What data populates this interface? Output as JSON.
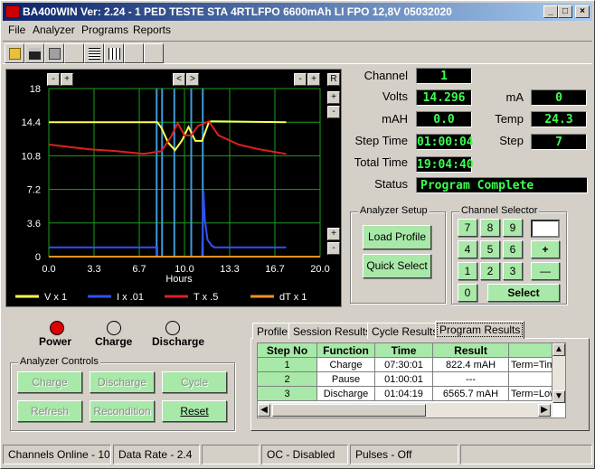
{
  "window": {
    "title": "BA400WIN Ver: 2.24 - 1 PED TESTE STA 4RTLFPO 6600mAh  LI FPO 12,8V 05032020",
    "controls": [
      "_",
      "□",
      "×"
    ]
  },
  "menu": [
    "File",
    "Analyzer",
    "Programs",
    "Reports"
  ],
  "toolbar": {
    "icons": [
      "open-folder-icon",
      "save-disk-icon",
      "print-icon",
      "grid-icon",
      "list-icon"
    ]
  },
  "chart": {
    "zoom_buttons": [
      "-",
      "+",
      "<",
      ">",
      "-",
      "+",
      "R",
      "+",
      "-",
      "+",
      "-"
    ],
    "xlabel": "Hours"
  },
  "chart_data": {
    "type": "line",
    "xlabel": "Hours",
    "xlim": [
      0.0,
      20.0
    ],
    "ylim": [
      0,
      18
    ],
    "x_ticks": [
      "0.0",
      "3.3",
      "6.7",
      "10.0",
      "13.3",
      "16.7",
      "20.0"
    ],
    "y_ticks": [
      "18",
      "14.4",
      "10.8",
      "7.2",
      "3.6",
      "0"
    ],
    "grid": true,
    "legend_position": "bottom",
    "series": [
      {
        "name": "V x 1",
        "color": "#ffff50",
        "x": [
          0,
          8,
          8.3,
          8.8,
          9.3,
          9.8,
          10.3,
          10.8,
          11.3,
          11.8,
          12,
          17.5
        ],
        "values": [
          14.4,
          14.4,
          13.8,
          12.2,
          11.4,
          12.4,
          13.9,
          12.4,
          12.4,
          14.4,
          14.5,
          14.4
        ]
      },
      {
        "name": "I x .01",
        "color": "#3050ff",
        "x": [
          0,
          7.9,
          8.0,
          8.0,
          11.3,
          11.4,
          11.5,
          11.7,
          11.8,
          12.0,
          12.2,
          17.5
        ],
        "values": [
          1.0,
          1.0,
          1.0,
          0.0,
          0.0,
          7.0,
          4.0,
          1.8,
          1.6,
          1.2,
          1.0,
          1.0
        ]
      },
      {
        "name": "T x .5",
        "color": "#e02020",
        "x": [
          0,
          3,
          5,
          7,
          8.3,
          9,
          9.5,
          10,
          10.5,
          11,
          11.8,
          12.5,
          14,
          15.5,
          17.5
        ],
        "values": [
          12.0,
          11.5,
          11.3,
          11.0,
          11.3,
          12.8,
          14.3,
          13.0,
          13.0,
          14.0,
          14.5,
          13.0,
          12.0,
          11.5,
          11.0
        ]
      },
      {
        "name": "dT x 1",
        "color": "#ff9020",
        "x": [
          0,
          20
        ],
        "values": [
          0,
          0
        ]
      }
    ]
  },
  "readouts": {
    "channel": {
      "label": "Channel",
      "value": "1"
    },
    "volts": {
      "label": "Volts",
      "value": "14.296"
    },
    "ma": {
      "label": "mA",
      "value": "0"
    },
    "mah": {
      "label": "mAH",
      "value": "0.0"
    },
    "temp": {
      "label": "Temp",
      "value": "24.3"
    },
    "step_time": {
      "label": "Step Time",
      "value": "01:00:04"
    },
    "step": {
      "label": "Step",
      "value": "7"
    },
    "total_time": {
      "label": "Total Time",
      "value": "19:04:40"
    },
    "status": {
      "label": "Status",
      "value": "Program Complete"
    }
  },
  "analyzer_setup": {
    "title": "Analyzer Setup",
    "load_profile": "Load Profile",
    "quick_select": "Quick Select"
  },
  "channel_selector": {
    "title": "Channel Selector",
    "keys": [
      "7",
      "8",
      "9",
      "4",
      "5",
      "6",
      "+",
      "1",
      "2",
      "3",
      "—",
      "0"
    ],
    "select": "Select",
    "input_value": ""
  },
  "indicators": {
    "power": "Power",
    "charge": "Charge",
    "discharge": "Discharge",
    "power_color": "#e00000"
  },
  "analyzer_controls": {
    "title": "Analyzer Controls",
    "charge": "Charge",
    "discharge": "Discharge",
    "cycle": "Cycle",
    "refresh": "Refresh",
    "recondition": "Recondition",
    "reset": "Reset"
  },
  "tabs": [
    "Profile",
    "Session Results",
    "Cycle Results",
    "Program Results"
  ],
  "results_table": {
    "headers": [
      "Step No",
      "Function",
      "Time",
      "Result",
      ""
    ],
    "rows": [
      [
        "1",
        "Charge",
        "07:30:01",
        "822.4 mAH",
        "Term=Tim"
      ],
      [
        "2",
        "Pause",
        "01:00:01",
        "---",
        ""
      ],
      [
        "3",
        "Discharge",
        "01:04:19",
        "6565.7 mAH",
        "Term=Low"
      ]
    ]
  },
  "statusbar": [
    "Channels Online - 10",
    "Data Rate - 2.4",
    "",
    "OC - Disabled",
    "Pulses - Off",
    ""
  ]
}
